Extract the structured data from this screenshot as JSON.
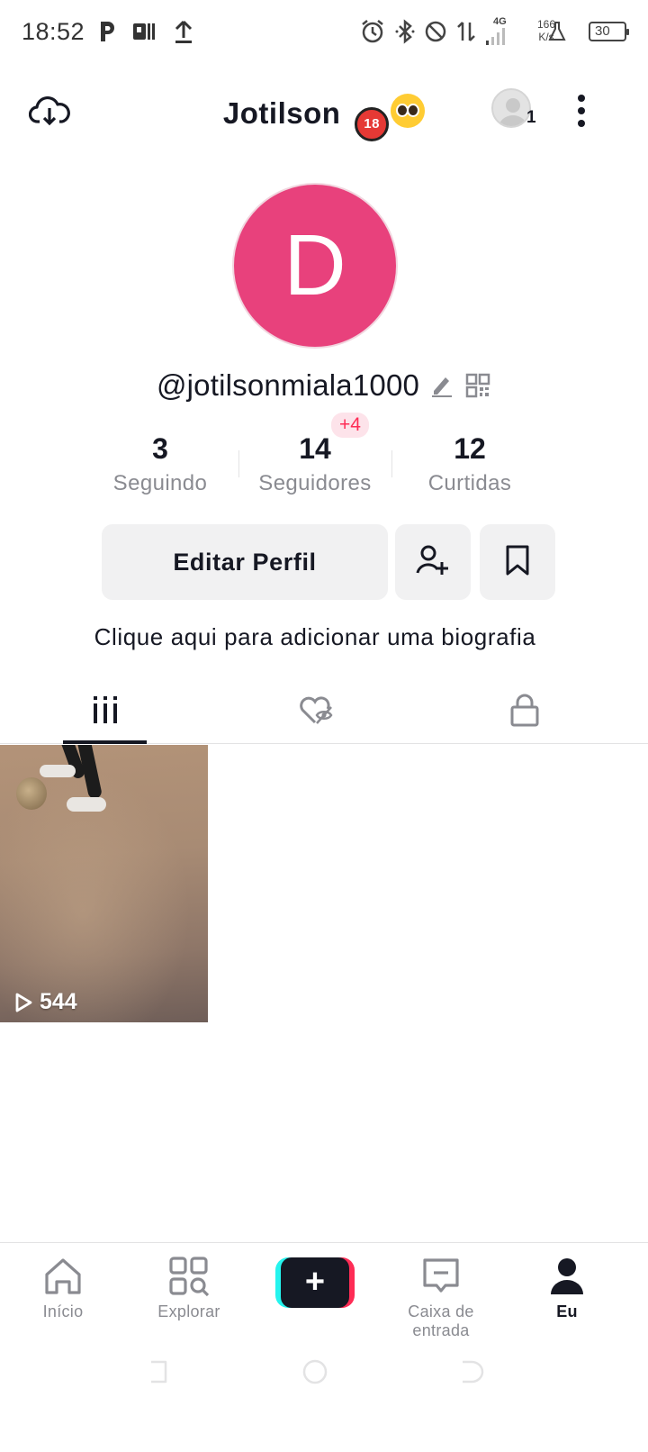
{
  "status_bar": {
    "time": "18:52",
    "net_type": "4G",
    "speed_value": "166",
    "speed_unit": "K/s",
    "battery": "30"
  },
  "header": {
    "title": "Jotilson",
    "emoji_18_text": "18",
    "account_badge": "1"
  },
  "profile": {
    "avatar_letter": "D",
    "avatar_color": "#e8417c",
    "username": "@jotilsonmiala1000",
    "stats": {
      "following": {
        "value": "3",
        "label": "Seguindo"
      },
      "followers": {
        "value": "14",
        "label": "Seguidores",
        "badge": "+4"
      },
      "likes": {
        "value": "12",
        "label": "Curtidas"
      }
    },
    "edit_button": "Editar Perfil",
    "bio_prompt": "Clique aqui para adicionar uma biografia"
  },
  "tabs": [
    {
      "icon": "grid-videos-icon",
      "active": true
    },
    {
      "icon": "liked-hidden-icon",
      "active": false
    },
    {
      "icon": "lock-icon",
      "active": false
    }
  ],
  "videos": [
    {
      "views": "544"
    }
  ],
  "bottom_nav": {
    "home": "Início",
    "explore": "Explorar",
    "create": "+",
    "inbox": "Caixa de entrada",
    "me": "Eu"
  },
  "colors": {
    "accent": "#fe2c55",
    "cyan": "#25f4ee",
    "text": "#161823",
    "muted": "#8a8b91"
  }
}
